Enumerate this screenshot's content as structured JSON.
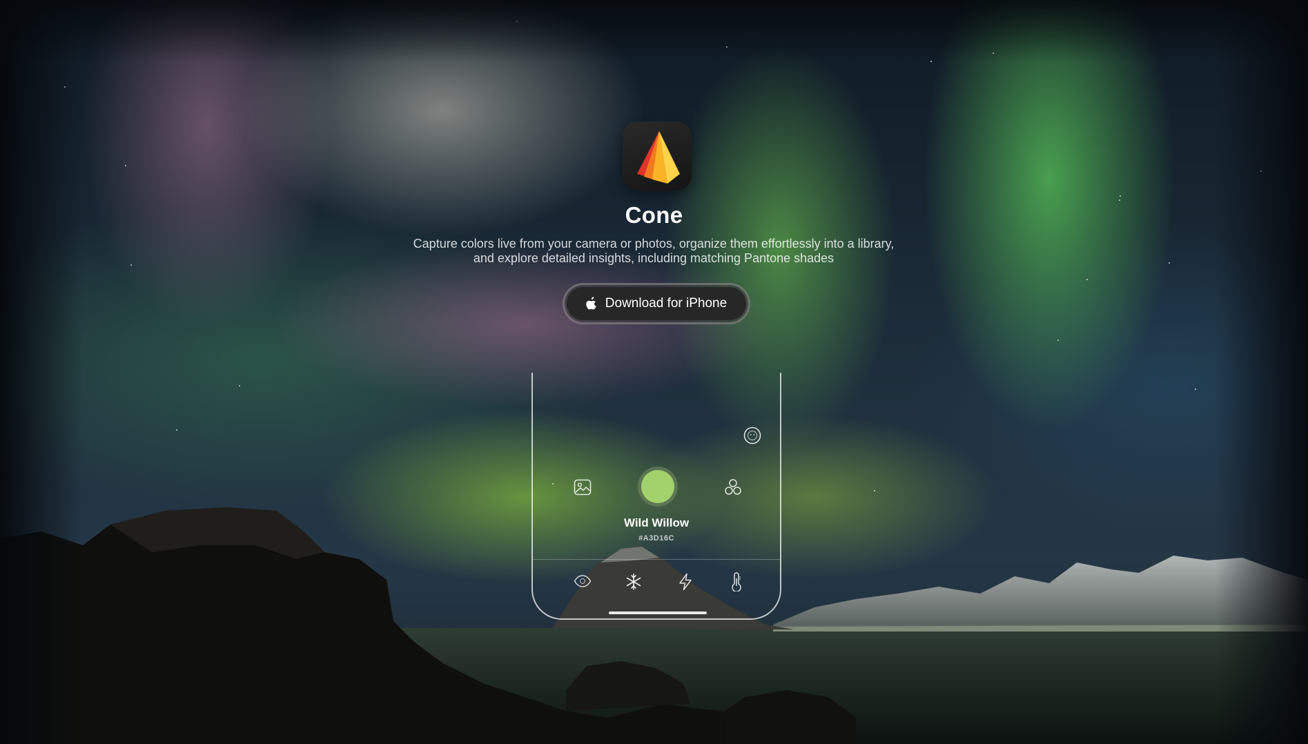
{
  "app": {
    "name": "Cone",
    "description": "Capture colors live from your camera or photos, organize them effortlessly into a library, and explore detailed insights, including matching Pantone shades",
    "icon": "cone-app-icon"
  },
  "cta": {
    "label": "Download for iPhone",
    "icon": "apple-icon"
  },
  "phone_preview": {
    "top_right_icon": "smiley-icon",
    "left_icon": "image-icon",
    "right_icon": "circles-icon",
    "color": {
      "name": "Wild Willow",
      "hex_label": "#A3D16C",
      "swatch": "#A3D16C"
    },
    "toolbar_icons": [
      "eye-icon",
      "snowflake-icon",
      "lightning-icon",
      "thermometer-icon"
    ]
  },
  "colors": {
    "background": "#0f1a24",
    "button": "#272727",
    "aurora_green": "#5fc35a",
    "aurora_pink": "#c985b0"
  }
}
